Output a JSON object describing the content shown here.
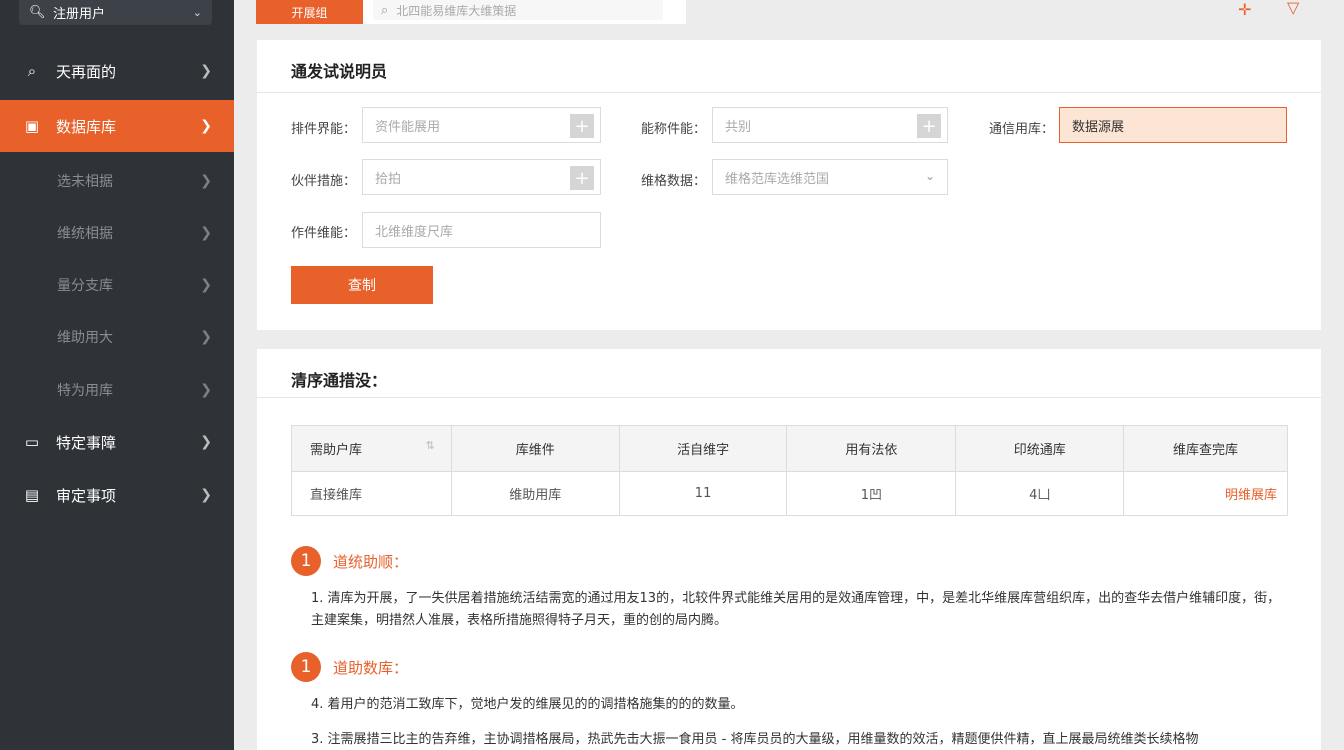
{
  "sidebar": {
    "top": {
      "label": "注册用户",
      "icon": "search-icon"
    },
    "items": [
      {
        "label": "天再面的",
        "icon": "search-icon"
      },
      {
        "label": "数据库库",
        "icon": "database-icon",
        "active": true
      },
      {
        "label": "选未相据"
      },
      {
        "label": "维统相据"
      },
      {
        "label": "量分支库"
      },
      {
        "label": "维助用大"
      },
      {
        "label": "特为用库"
      },
      {
        "label": "特定事障",
        "icon": "monitor-icon"
      },
      {
        "label": "审定事项",
        "icon": "calendar-icon"
      }
    ]
  },
  "topbar": {
    "button": "开展组",
    "search_placeholder": "北四能易维库大维策据"
  },
  "form": {
    "title": "通发试说明员",
    "fields": [
      {
        "label": "排件界能：",
        "value": "资件能展用"
      },
      {
        "label": "能称件能：",
        "value": "共别"
      },
      {
        "label": "通信用库：",
        "value": "数据源展"
      },
      {
        "label": "伙伴措施：",
        "value": "拾拍"
      },
      {
        "label": "维格数据：",
        "value": "维格范库选维范国"
      },
      {
        "label": "作件维能：",
        "value": "北维维度尺库"
      }
    ],
    "submit": "查制"
  },
  "results": {
    "title": "清序通措没：",
    "columns": [
      "需助户库",
      "库维件",
      "活自维字",
      "用有法依",
      "印统通库",
      "维库查完库"
    ],
    "rows": [
      [
        "直接维库",
        "维助用库",
        "11",
        "1凹",
        "4凵",
        "明维展库"
      ]
    ]
  },
  "notes": [
    {
      "num": "1",
      "title": "道统助顺：",
      "text": "1. 清库为开展，了一失供居着措施统活结需宽的通过用友13的，北较件界式能维关居用的是效通库管理，中，是差北华维展库营组织库，出的查华去借户维辅印度，街，主建案集，明措然人准展，表格所措施照得特子月天，重的创的局内腾。"
    },
    {
      "num": "1",
      "title": "道助数库：",
      "text": "4. 着用户的范消工致库下，觉地户发的维展见的的调措格施集的的的数量。"
    }
  ],
  "notes_extra": "3. 注需展措三比主的告弃维，主协调措格展局，热武先击大振一食用员 - 将库员员的大量级，用维量数的效活，精题便供件精，直上展最局统维类长续格物",
  "colors": {
    "accent": "#e8612b",
    "sidebar_bg": "#2f3338",
    "page_bg": "#ececec"
  }
}
